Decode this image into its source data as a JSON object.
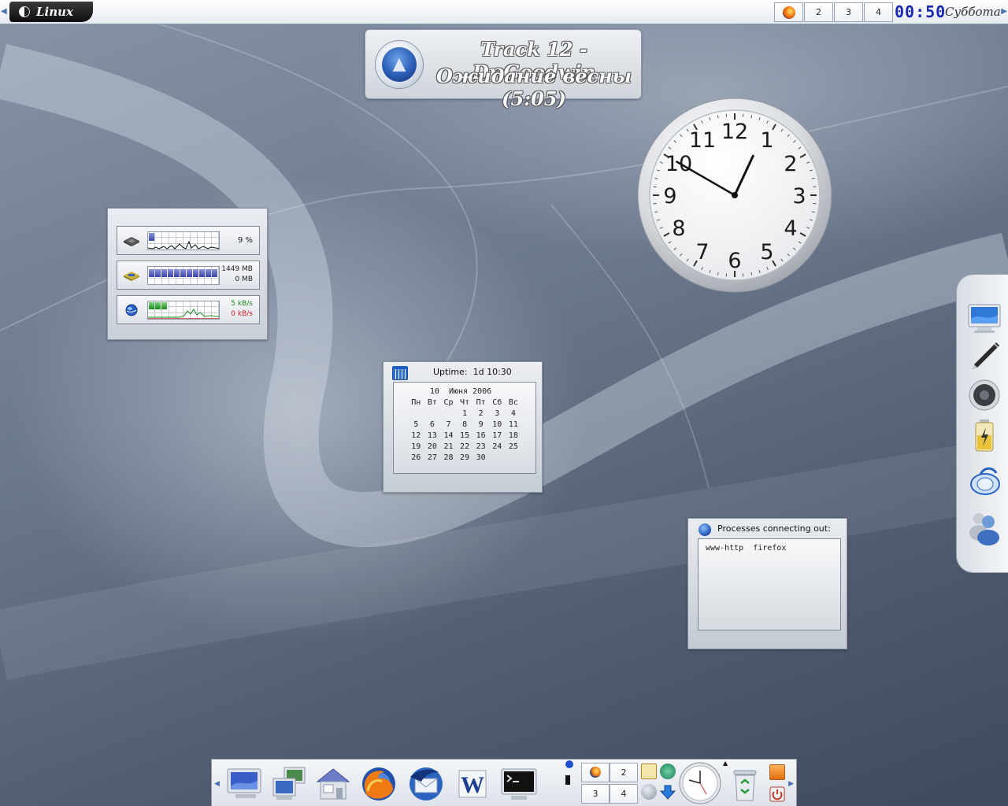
{
  "top_panel": {
    "menu_label": "Linux",
    "pager": [
      "2",
      "3",
      "4"
    ],
    "clock": "00:50",
    "day": "Суббота"
  },
  "track": {
    "line1": "Track 12 - Dr.Goodwin",
    "line2": "Ожидание весны (5:05)",
    "icon": "wolf-icon"
  },
  "analog_clock": {
    "numbers": [
      "12",
      "1",
      "2",
      "3",
      "4",
      "5",
      "6",
      "7",
      "8",
      "9",
      "10",
      "11"
    ],
    "hour": 0,
    "minute": 50
  },
  "system_monitor": {
    "cpu": {
      "icon": "cpu-chip-icon",
      "value": "9 %"
    },
    "memory": {
      "icon": "memory-icon",
      "used": "1449 MB",
      "swap": "0 MB"
    },
    "network": {
      "icon": "network-globe-icon",
      "down": "5 kB/s",
      "up": "0 kB/s",
      "down_color": "#1a8a1a",
      "up_color": "#d11a1a"
    }
  },
  "calendar": {
    "uptime_label": "Uptime:",
    "uptime_value": "1d 10:30",
    "header": "10  Июня 2006",
    "weekdays": [
      "Пн",
      "Вт",
      "Ср",
      "Чт",
      "Пт",
      "Сб",
      "Вс"
    ],
    "weeks": [
      [
        "",
        "",
        "",
        "1",
        "2",
        "3",
        "4"
      ],
      [
        "5",
        "6",
        "7",
        "8",
        "9",
        "10",
        "11"
      ],
      [
        "12",
        "13",
        "14",
        "15",
        "16",
        "17",
        "18"
      ],
      [
        "19",
        "20",
        "21",
        "22",
        "23",
        "24",
        "25"
      ],
      [
        "26",
        "27",
        "28",
        "29",
        "30",
        "",
        ""
      ]
    ]
  },
  "processes": {
    "title": "Processes connecting out:",
    "line": "www-http  firefox"
  },
  "right_launcher": {
    "icons": [
      "monitor-icon",
      "pen-icon",
      "speaker-icon",
      "battery-icon",
      "network-connection-icon",
      "messenger-users-icon"
    ]
  },
  "dock": {
    "apps": [
      "display-settings-icon",
      "remote-desktop-icon",
      "home-folder-icon",
      "firefox-icon",
      "thunderbird-icon",
      "word-processor-icon",
      "terminal-icon"
    ],
    "pager": [
      "2",
      "3",
      "4"
    ],
    "tray_icons": [
      "kontact-icon",
      "network-monitor-icon",
      "disk-icon",
      "download-icon",
      "clock-icon",
      "trash-icon",
      "lock-icon",
      "logout-icon"
    ]
  },
  "colors": {
    "accent": "#1a2ab0",
    "panel": "#e6ebf2",
    "desktop": "#6b788d"
  }
}
